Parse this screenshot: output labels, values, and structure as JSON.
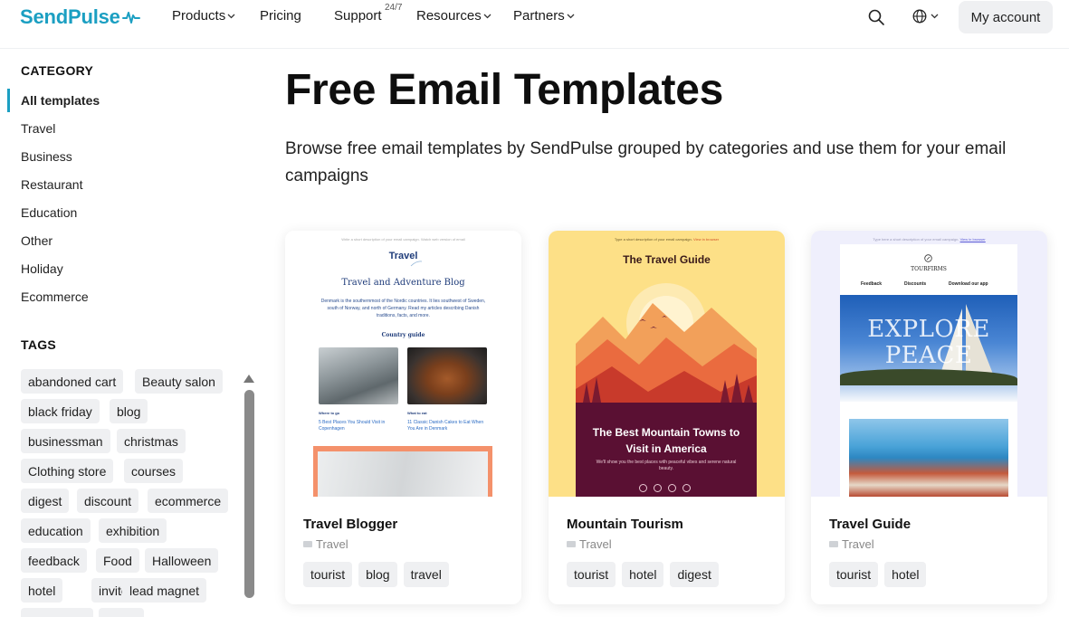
{
  "header": {
    "logo_text": "SendPulse",
    "nav": {
      "products": "Products",
      "pricing": "Pricing",
      "support": "Support",
      "support_badge": "24/7",
      "resources": "Resources",
      "partners": "Partners"
    },
    "account_label": "My account",
    "icons": [
      "search-icon",
      "globe-icon",
      "chevron-down-icon"
    ]
  },
  "sidebar": {
    "category_heading": "CATEGORY",
    "categories": [
      "All templates",
      "Travel",
      "Business",
      "Restaurant",
      "Education",
      "Other",
      "Holiday",
      "Ecommerce"
    ],
    "active_category": "All templates",
    "tags_heading": "TAGS",
    "tags": [
      "abandoned cart",
      "Beauty salon",
      "black friday",
      "blog",
      "businessman",
      "christmas",
      "Clothing store",
      "courses",
      "digest",
      "discount",
      "ecommerce",
      "education",
      "exhibition",
      "feedback",
      "Food",
      "Halloween",
      "hotel",
      "invite",
      "lead magnet"
    ]
  },
  "main": {
    "title": "Free Email Templates",
    "description": "Browse free email templates by SendPulse grouped by categories and use them for your email campaigns",
    "cards": [
      {
        "title": "Travel Blogger",
        "category": "Travel",
        "tags": [
          "tourist",
          "blog",
          "travel"
        ],
        "preview": {
          "preheader": "Write a short description of your email campaign. Watch web version of email",
          "logo": "Travel",
          "heading": "Travel and Adventure Blog",
          "intro": "Denmark is the southernmost of the Nordic countries. It lies southwest of Sweden, south of Norway, and north of Germany. Read my articles describing Danish traditions, facts, and more.",
          "section": "Country guide",
          "left_label": "Where to go",
          "left_link": "5 Best Places You Should Visit in Copenhagen",
          "right_label": "What to eat",
          "right_link": "11 Classic Danish Cakes to Eat When You Are in Denmark"
        }
      },
      {
        "title": "Mountain Tourism",
        "category": "Travel",
        "tags": [
          "tourist",
          "hotel",
          "digest"
        ],
        "preview": {
          "preheader": "Type a short description of your email campaign.",
          "preheader_link": "View in browser",
          "heading": "The Travel Guide",
          "headline": "The Best Mountain Towns to Visit in America",
          "subtext": "We'll show you the best places with peaceful vibes and serene natural beauty."
        }
      },
      {
        "title": "Travel Guide",
        "category": "Travel",
        "tags": [
          "tourist",
          "hotel"
        ],
        "preview": {
          "preheader": "Type here a short description of your email campaign.",
          "preheader_link": "View in browser",
          "brand": "TOURFIRMS",
          "menu": [
            "Feedback",
            "Discounts",
            "Download our app"
          ],
          "hero_line1": "EXPLORE",
          "hero_line2": "PEACE"
        }
      }
    ]
  },
  "colors": {
    "brand": "#1b9fc2",
    "tag_bg": "#eff0f2",
    "mountain_bg": "#fde087",
    "mountain_dark": "#5a1033",
    "travel_orange": "#f4916b"
  }
}
